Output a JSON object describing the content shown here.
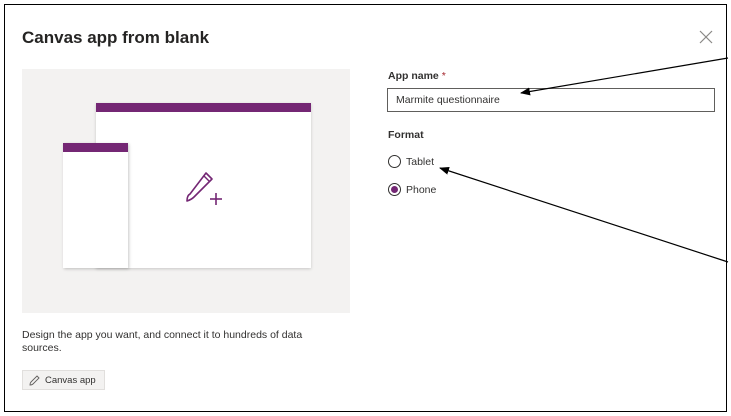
{
  "dialog": {
    "title": "Canvas app from blank",
    "close_icon": "close-icon",
    "description": "Design the app you want, and connect it to hundreds of data sources.",
    "template_chip": {
      "label": "Canvas app",
      "icon": "brush-icon"
    }
  },
  "form": {
    "app_name_label": "App name",
    "required_marker": "*",
    "app_name_value": "Marmite questionnaire",
    "format_label": "Format",
    "format_options": [
      {
        "label": "Tablet",
        "selected": false
      },
      {
        "label": "Phone",
        "selected": true
      }
    ]
  },
  "colors": {
    "accent": "#742774",
    "illustration_bg": "#f3f2f1",
    "annotation": "#000000"
  }
}
